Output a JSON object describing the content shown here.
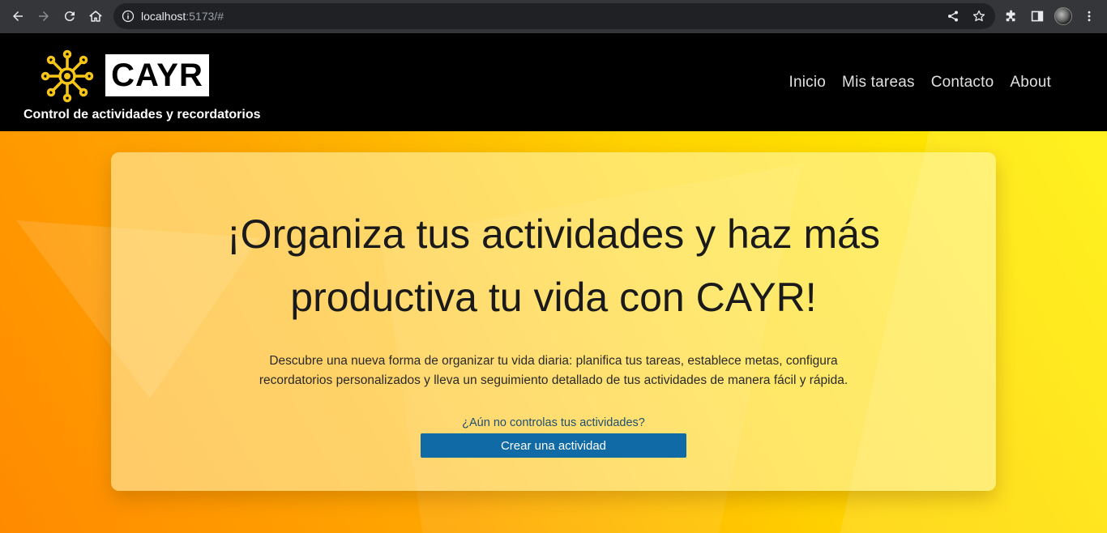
{
  "browser": {
    "url_host": "localhost",
    "url_rest": ":5173/#"
  },
  "site": {
    "logo_text": "CAYR",
    "tagline": "Control de actividades y recordatorios",
    "nav": [
      "Inicio",
      "Mis tareas",
      "Contacto",
      "About"
    ]
  },
  "hero": {
    "headline_line1": "¡Organiza tus actividades y haz más",
    "headline_line2": "productiva tu vida con CAYR!",
    "desc_line1": "Descubre una nueva forma de organizar tu vida diaria: planifica tus tareas, establece metas, configura",
    "desc_line2": "recordatorios personalizados y lleva un seguimiento detallado de tus actividades de manera fácil y rápida.",
    "cta_question": "¿Aún no controlas tus actividades?",
    "cta_button": "Crear una actividad"
  },
  "colors": {
    "brand_yellow": "#f5c518",
    "cta_blue": "#0f6aa6",
    "header_bg": "#000000"
  }
}
